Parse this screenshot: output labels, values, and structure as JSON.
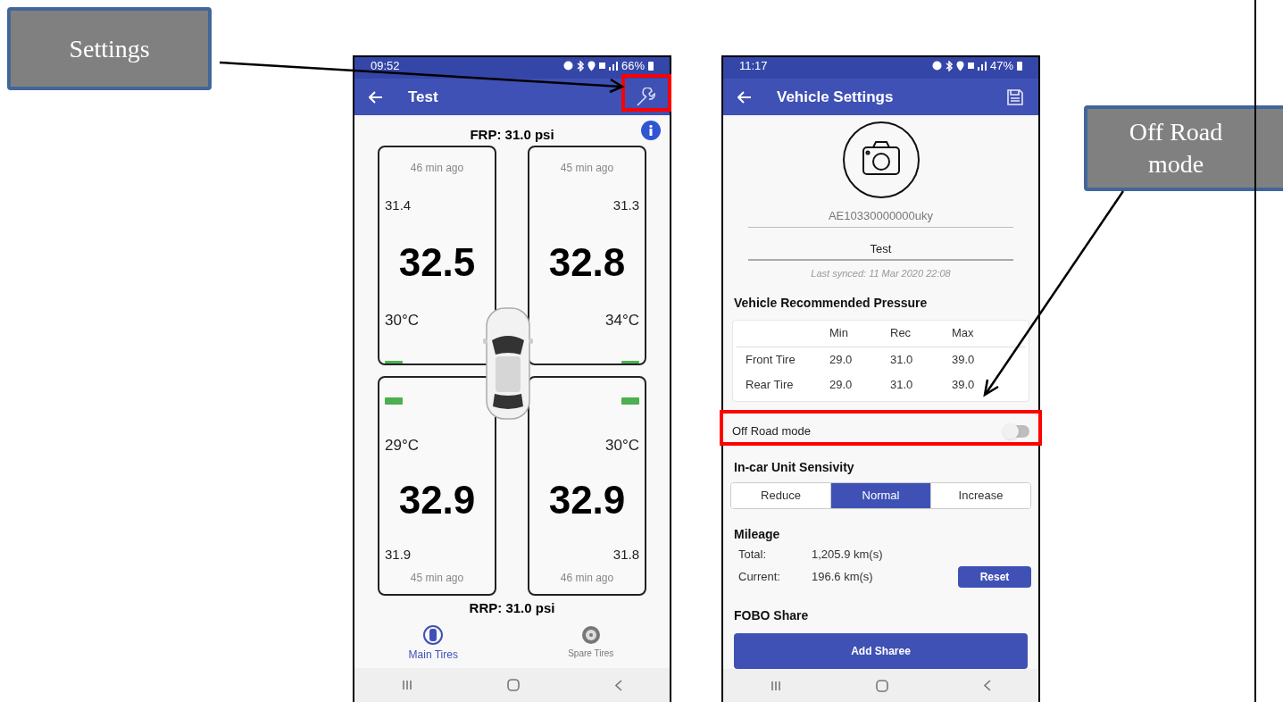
{
  "callouts": [
    {
      "text": "Settings"
    },
    {
      "text": "Off Road mode"
    }
  ],
  "tire_screen": {
    "status_bar": {
      "time": "09:52",
      "battery": "66%"
    },
    "title": "Test",
    "front_pressure": "FRP: 31.0 psi",
    "front_tires": [
      {
        "updated": "46 min ago",
        "reading": "31.4",
        "pressure": "32.5",
        "temperature": "30°C"
      },
      {
        "updated": "45 min ago",
        "reading": "31.3",
        "pressure": "32.8",
        "temperature": "34°C"
      }
    ],
    "rear_tires": [
      {
        "updated": "45 min ago",
        "reading": "31.9",
        "pressure": "32.9",
        "temperature": "29°C"
      },
      {
        "updated": "46 min ago",
        "reading": "31.8",
        "pressure": "32.9",
        "temperature": "30°C"
      }
    ],
    "rear_pressure": "RRP: 31.0 psi",
    "nav": [
      {
        "label": "Main Tires",
        "selected": true
      },
      {
        "label": "Spare Tires",
        "selected": false
      }
    ]
  },
  "settings_screen": {
    "status_bar": {
      "time": "11:17",
      "battery": "47%"
    },
    "title": "Vehicle Settings",
    "device_id": "AE10330000000uky",
    "vehicle_name": "Test",
    "last_synced": "Last synced: 11 Mar 2020 22:08",
    "pressure_heading": "Vehicle Recommended Pressure",
    "pressure_table": {
      "columns": [
        "Min",
        "Rec",
        "Max"
      ],
      "rows": [
        {
          "label": "Front Tire",
          "values": [
            "29.0",
            "31.0",
            "39.0"
          ]
        },
        {
          "label": "Rear Tire",
          "values": [
            "29.0",
            "31.0",
            "39.0"
          ]
        }
      ]
    },
    "off_road": {
      "label": "Off Road mode",
      "on": false
    },
    "sensitivity_heading": "In-car Unit Sensivity",
    "sensitivity": [
      {
        "label": "Reduce",
        "selected": false
      },
      {
        "label": "Normal",
        "selected": true
      },
      {
        "label": "Increase",
        "selected": false
      }
    ],
    "mileage_heading": "Mileage",
    "mileage": [
      {
        "label": "Total:",
        "value": "1,205.9 km(s)"
      },
      {
        "label": "Current:",
        "value": "196.6 km(s)"
      }
    ],
    "reset_button": "Reset",
    "share_heading": "FOBO Share",
    "add_button": "Add Sharee"
  }
}
